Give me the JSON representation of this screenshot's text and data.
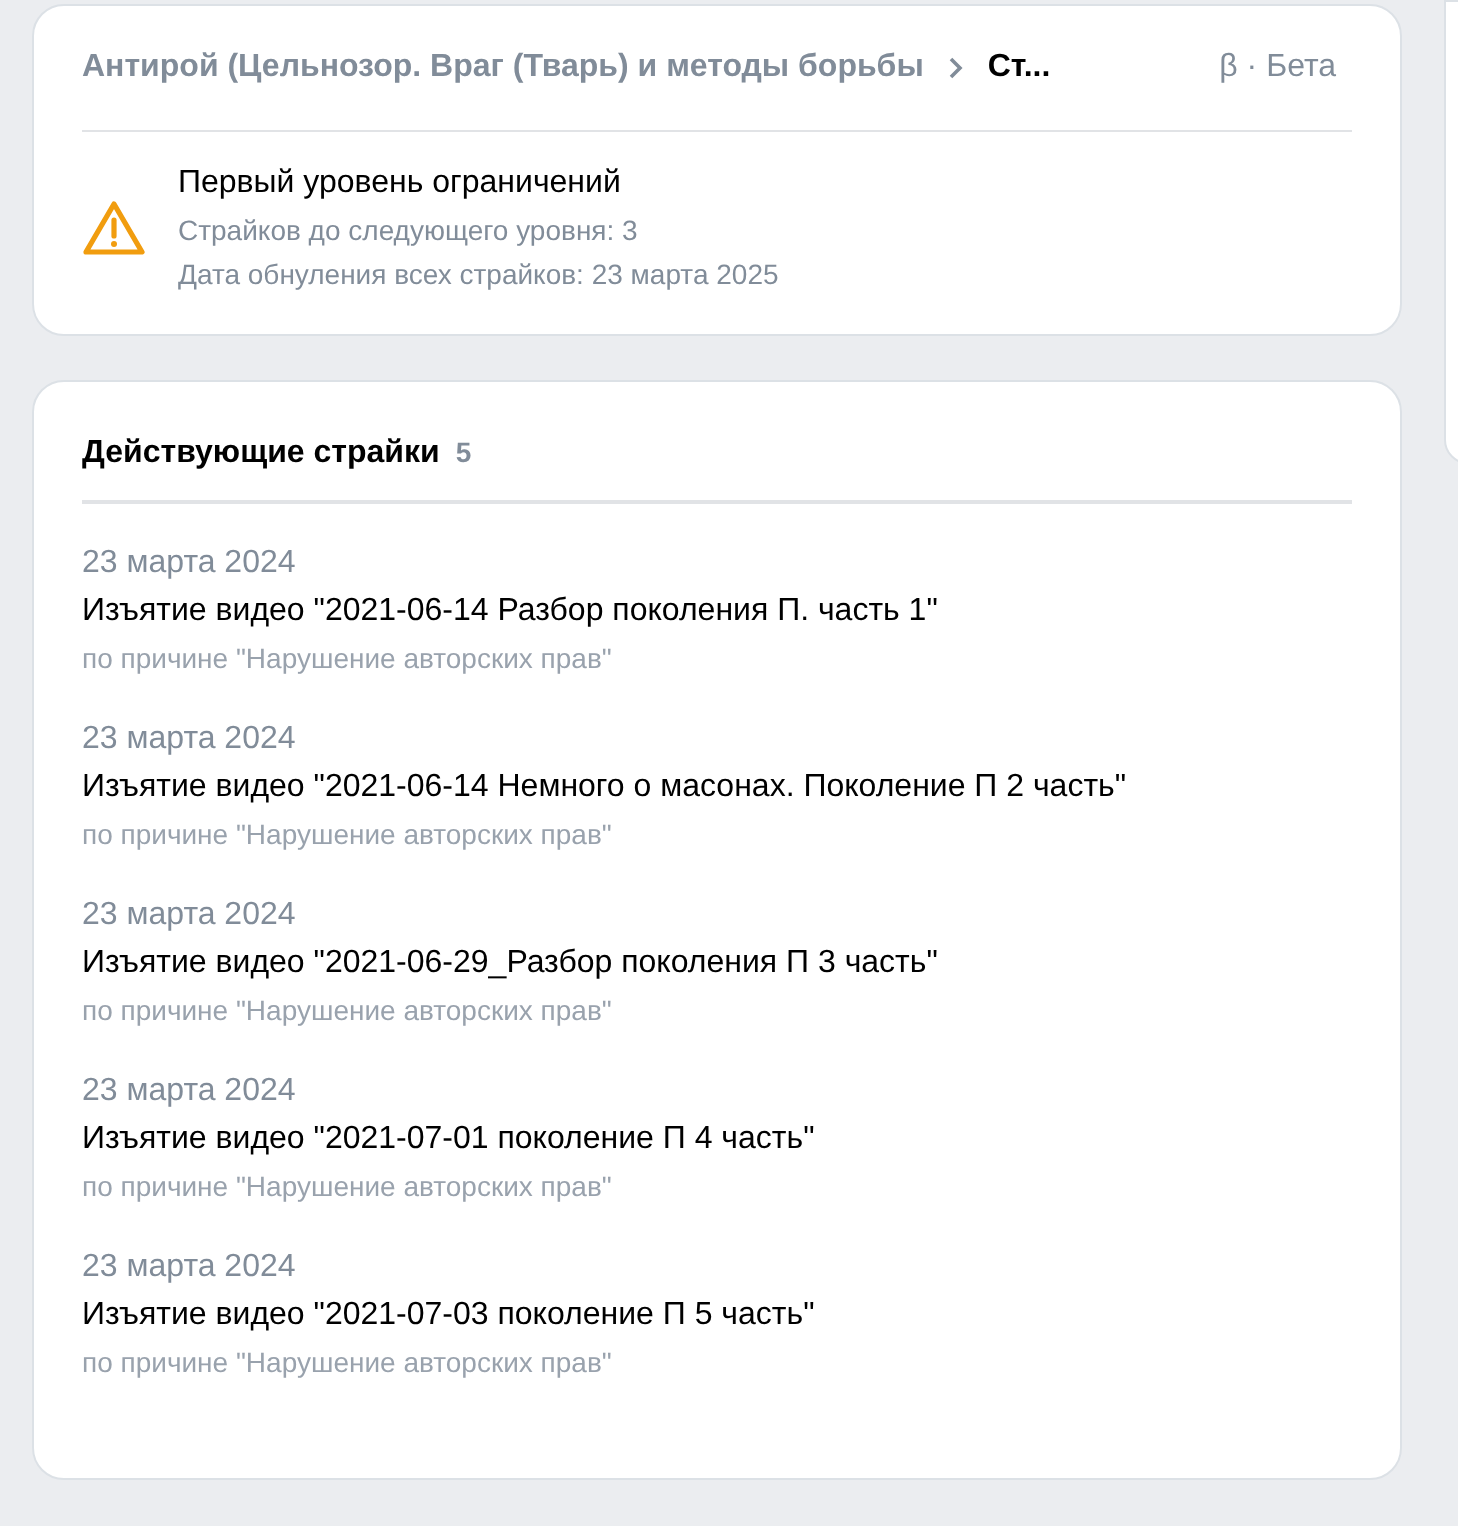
{
  "breadcrumb": {
    "items": [
      "Антирой (Цельнозор. Враг (Тварь) и методы борьбы",
      "Ст..."
    ],
    "badge": "β · Бета"
  },
  "restriction": {
    "title": "Первый уровень ограничений",
    "lines": [
      "Страйков до следующего уровня: 3",
      "Дата обнуления всех страйков: 23 марта 2025"
    ]
  },
  "strikes": {
    "title": "Действующие страйки",
    "count": "5",
    "items": [
      {
        "date": "23 марта 2024",
        "text": "Изъятие видео \"2021-06-14 Разбор поколения П. часть 1\"",
        "reason": "по причине \"Нарушение авторских прав\""
      },
      {
        "date": "23 марта 2024",
        "text": "Изъятие видео \"2021-06-14 Немного о масонах. Поколение П 2 часть\"",
        "reason": "по причине \"Нарушение авторских прав\""
      },
      {
        "date": "23 марта 2024",
        "text": "Изъятие видео \"2021-06-29_Разбор поколения П 3 часть\"",
        "reason": "по причине \"Нарушение авторских прав\""
      },
      {
        "date": "23 марта 2024",
        "text": "Изъятие видео \"2021-07-01 поколение П 4 часть\"",
        "reason": "по причине \"Нарушение авторских прав\""
      },
      {
        "date": "23 марта 2024",
        "text": "Изъятие видео \"2021-07-03 поколение П 5 часть\"",
        "reason": "по причине \"Нарушение авторских прав\""
      }
    ]
  }
}
